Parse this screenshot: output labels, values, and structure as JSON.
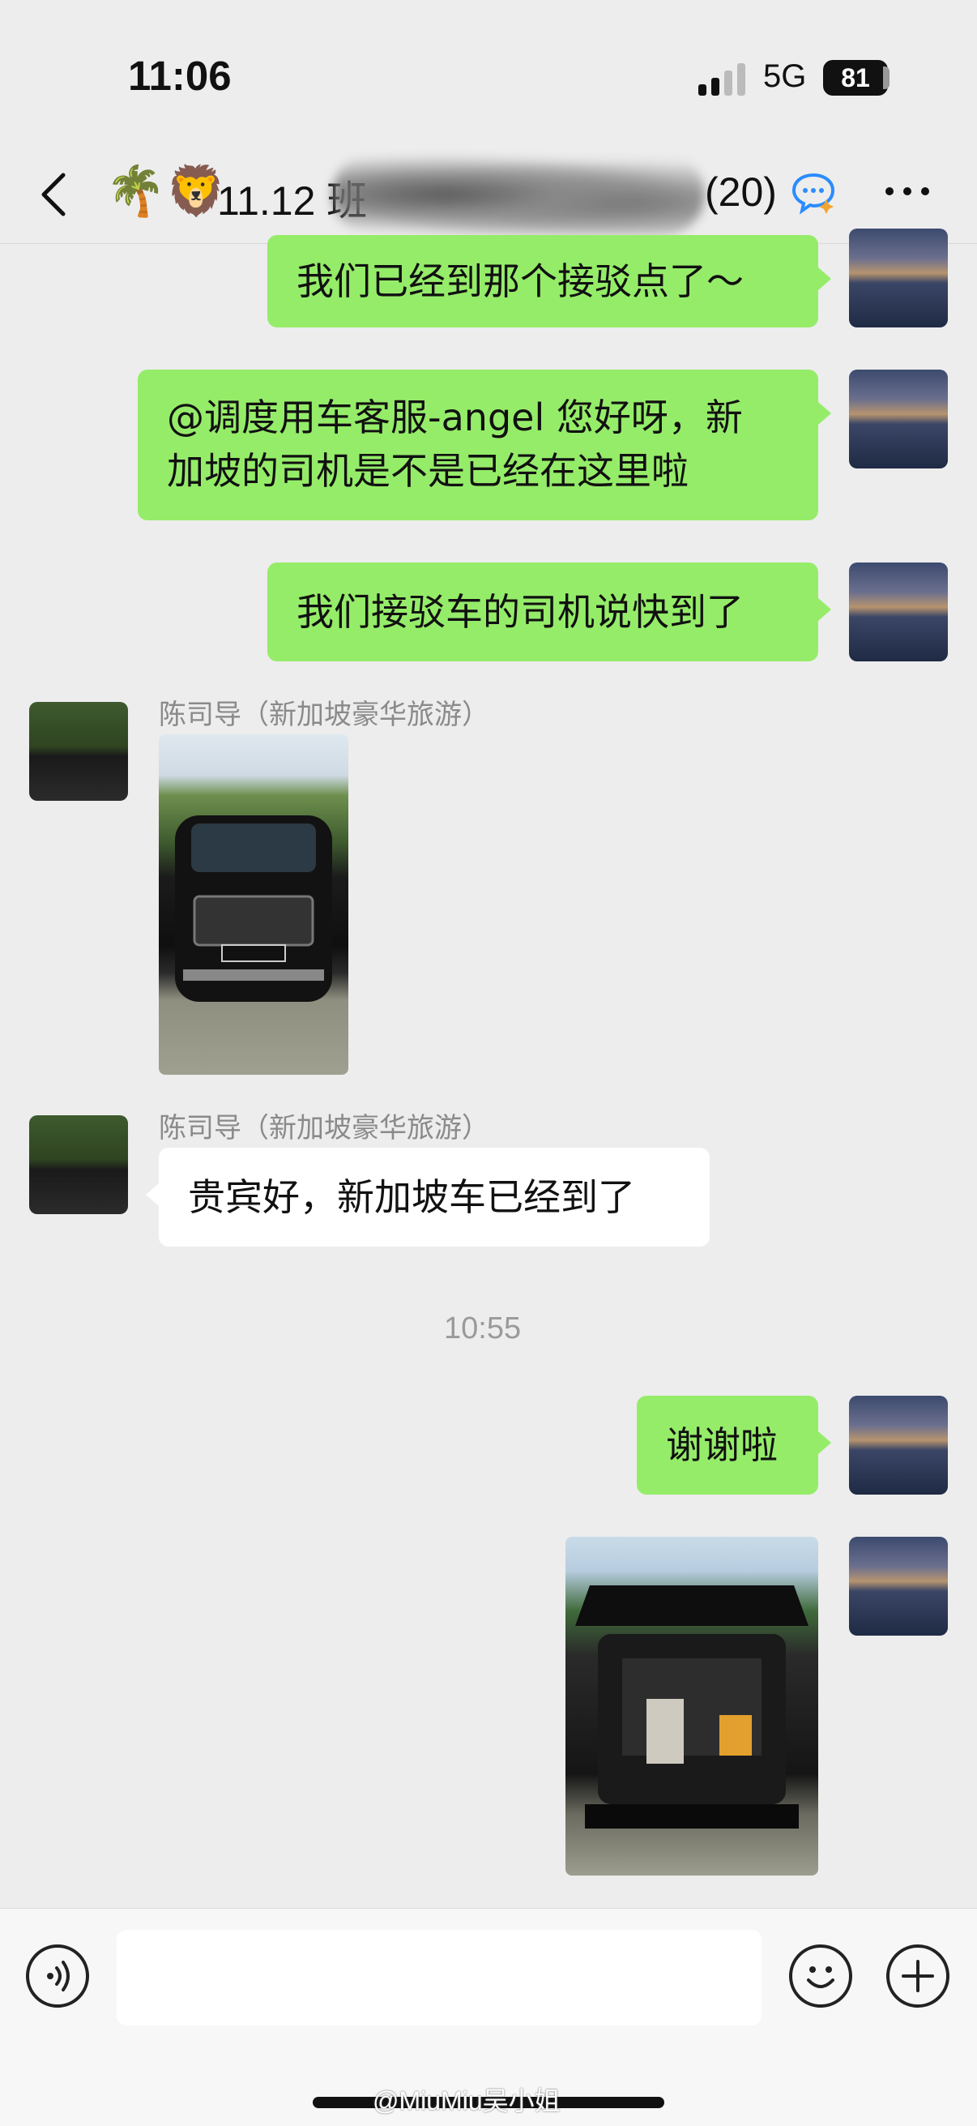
{
  "status": {
    "time": "11:06",
    "network": "5G",
    "battery": "81"
  },
  "header": {
    "emoji": "🌴🦁",
    "title": "11.12 班",
    "count": "(20)"
  },
  "messages": {
    "m1": "我们已经到那个接驳点了～",
    "m2_line1": "@调度用车客服-angel 您好呀，新",
    "m2_line2": "加坡的司机是不是已经在这里啦",
    "m3": "我们接驳车的司机说快到了",
    "sender1": "陈司导（新加坡豪华旅游）",
    "sender2": "陈司导（新加坡豪华旅游）",
    "m5": "贵宾好，新加坡车已经到了",
    "timestamp": "10:55",
    "m6": "谢谢啦"
  },
  "watermark": "@MiuMiu吴小姐"
}
